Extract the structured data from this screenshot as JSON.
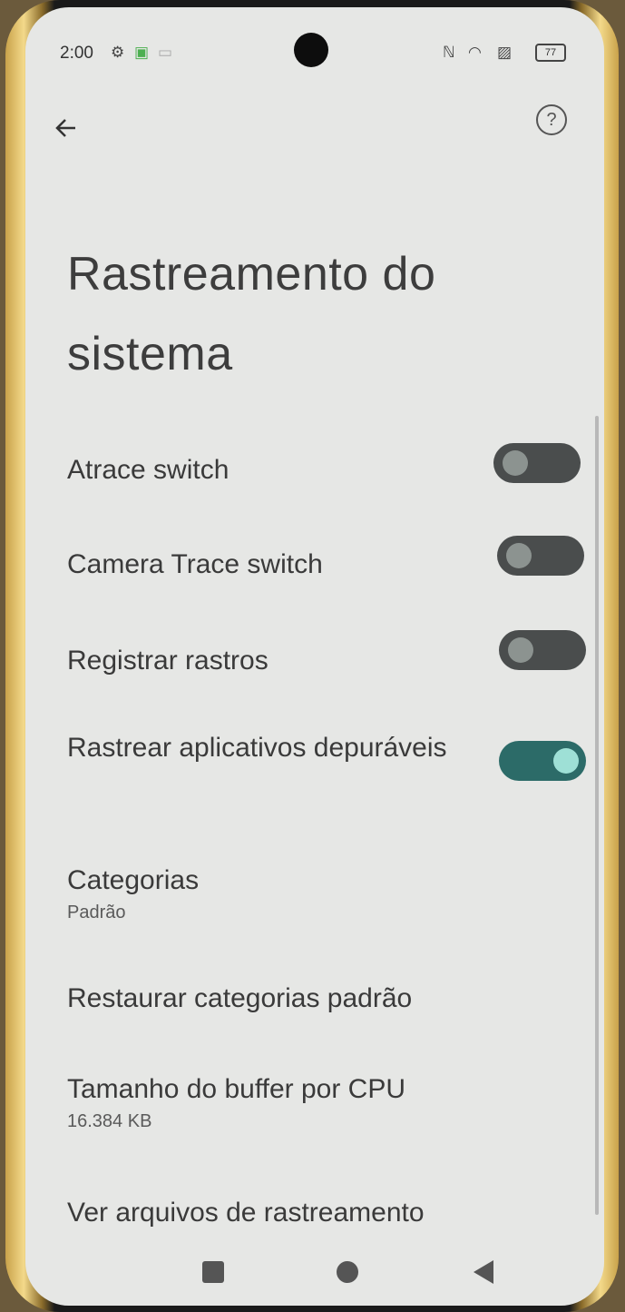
{
  "status_bar": {
    "time": "2:00",
    "battery": "77"
  },
  "app_bar": {
    "title": "Rastreamento do sistema"
  },
  "settings": [
    {
      "label": "Atrace switch",
      "type": "toggle",
      "checked": false
    },
    {
      "label": "Camera Trace switch",
      "type": "toggle",
      "checked": false
    },
    {
      "label": "Registrar rastros",
      "type": "toggle",
      "checked": false
    },
    {
      "label": "Rastrear aplicativos depuráveis",
      "type": "toggle",
      "checked": true
    },
    {
      "label": "Categorias",
      "summary": "Padrão",
      "type": "item"
    },
    {
      "label": "Restaurar categorias padrão",
      "type": "item"
    },
    {
      "label": "Tamanho do buffer por CPU",
      "summary": "16.384 KB",
      "type": "item"
    },
    {
      "label": "Ver arquivos de rastreamento",
      "type": "item"
    }
  ],
  "icons": {
    "back": "arrow-left-icon",
    "help": "question-circle-icon",
    "recents": "square-icon",
    "home": "circle-icon",
    "nav_back": "triangle-left-icon"
  }
}
